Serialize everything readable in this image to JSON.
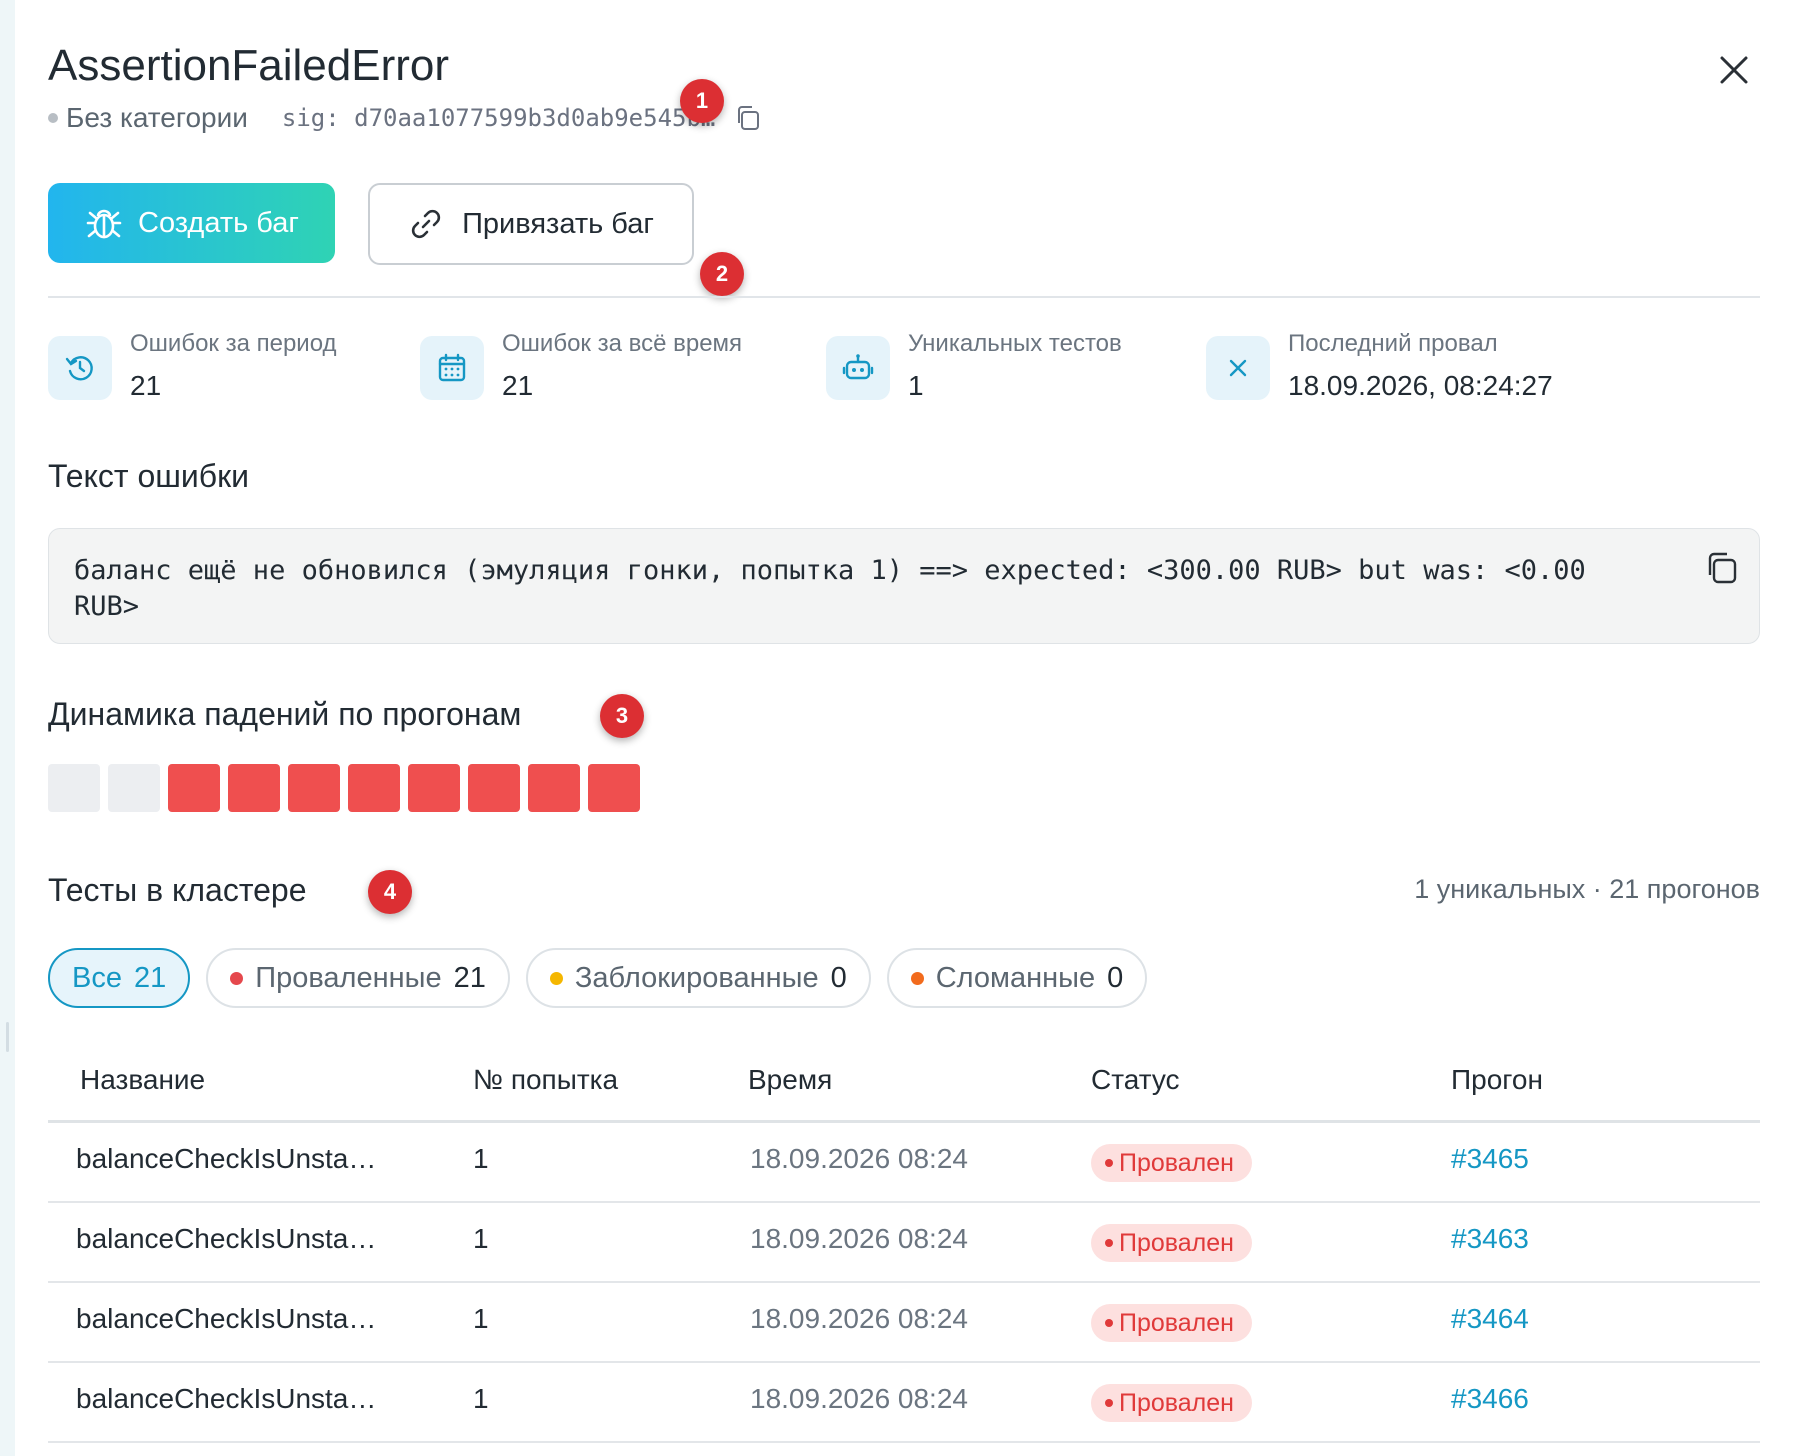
{
  "header": {
    "title": "AssertionFailedError",
    "category": "Без категории",
    "signature": "sig: d70aa1077599b3d0ab9e545b…",
    "copy_signature_icon": "copy-icon",
    "close_icon": "close-icon"
  },
  "annotations": [
    "1",
    "2",
    "3",
    "4"
  ],
  "actions": {
    "create_bug": {
      "label": "Создать баг",
      "icon": "bug-icon"
    },
    "link_bug": {
      "label": "Привязать баг",
      "icon": "link-icon"
    }
  },
  "stats": [
    {
      "label": "Ошибок за период",
      "value": "21",
      "icon": "history-icon"
    },
    {
      "label": "Ошибок за всё время",
      "value": "21",
      "icon": "calendar-icon"
    },
    {
      "label": "Уникальных тестов",
      "value": "1",
      "icon": "robot-icon"
    },
    {
      "label": "Последний провал",
      "value": "18.09.2026, 08:24:27",
      "icon": "x-icon"
    }
  ],
  "error_section": {
    "title": "Текст ошибки",
    "text": "баланс ещё не обновился (эмуляция гонки, попытка 1) ==> expected: <300.00 RUB> but was: <0.00 RUB>",
    "copy_icon": "copy-icon"
  },
  "dynamics": {
    "title": "Динамика падений по прогонам",
    "runs": [
      "none",
      "none",
      "failed",
      "failed",
      "failed",
      "failed",
      "failed",
      "failed",
      "failed",
      "failed"
    ],
    "colors": {
      "none": "#eceef1",
      "failed": "#ef4f4f"
    }
  },
  "cluster": {
    "title": "Тесты в кластере",
    "meta": "1 уникальных · 21 прогонов",
    "filters": [
      {
        "label": "Все",
        "count": "21",
        "active": true,
        "dot_color": ""
      },
      {
        "label": "Проваленные",
        "count": "21",
        "active": false,
        "dot_color": "#e5484d"
      },
      {
        "label": "Заблокированные",
        "count": "0",
        "active": false,
        "dot_color": "#f5b700"
      },
      {
        "label": "Сломанные",
        "count": "0",
        "active": false,
        "dot_color": "#f26b1d"
      }
    ],
    "columns": [
      "Название",
      "№ попытка",
      "Время",
      "Статус",
      "Прогон"
    ],
    "rows": [
      {
        "name": "balanceCheckIsUnsta…",
        "attempt": "1",
        "time": "18.09.2026 08:24",
        "status": "Провален",
        "run": "#3465"
      },
      {
        "name": "balanceCheckIsUnsta…",
        "attempt": "1",
        "time": "18.09.2026 08:24",
        "status": "Провален",
        "run": "#3463"
      },
      {
        "name": "balanceCheckIsUnsta…",
        "attempt": "1",
        "time": "18.09.2026 08:24",
        "status": "Провален",
        "run": "#3464"
      },
      {
        "name": "balanceCheckIsUnsta…",
        "attempt": "1",
        "time": "18.09.2026 08:24",
        "status": "Провален",
        "run": "#3466"
      }
    ]
  },
  "colors": {
    "accent": "#1597c4",
    "badge": "#dc2f33",
    "status_failed_bg": "#fde0df",
    "status_failed_text": "#e03a3a"
  }
}
